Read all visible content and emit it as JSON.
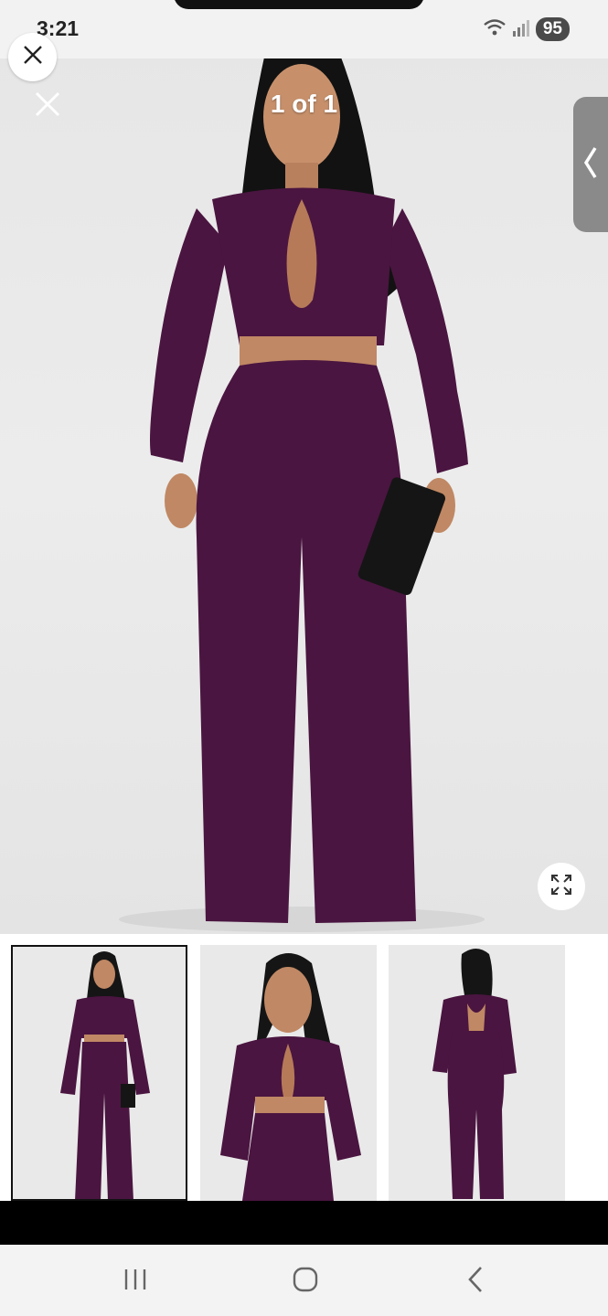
{
  "status_bar": {
    "time": "3:21",
    "battery": "95",
    "icons": [
      "wifi-icon",
      "signal-icon"
    ]
  },
  "viewer": {
    "counter": "1 of 1",
    "icons": [
      "close-icon",
      "close-icon",
      "chevron-left-icon",
      "expand-icon"
    ]
  },
  "colors": {
    "outfit": "#4a1540",
    "background": "#e8e8e8"
  },
  "thumbnails": [
    {
      "view": "front-full",
      "selected": true
    },
    {
      "view": "front-closeup",
      "selected": false
    },
    {
      "view": "back",
      "selected": false
    }
  ],
  "nav_bar": {
    "icons": [
      "recents-icon",
      "home-icon",
      "back-icon"
    ]
  }
}
